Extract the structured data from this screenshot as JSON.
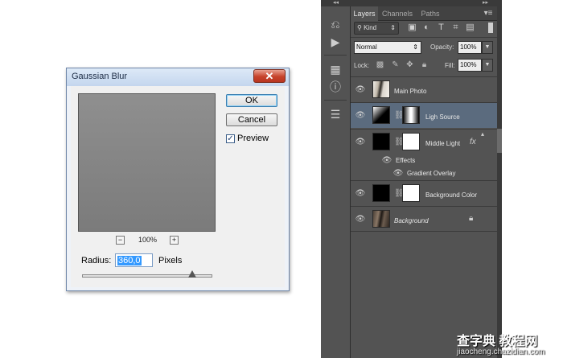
{
  "dialog": {
    "title": "Gaussian Blur",
    "close_glyph": "✕",
    "ok_label": "OK",
    "cancel_label": "Cancel",
    "preview_label": "Preview",
    "preview_checked": true,
    "zoom_out_glyph": "−",
    "zoom_in_glyph": "+",
    "zoom_level": "100%",
    "radius_label": "Radius:",
    "radius_value": "360,0",
    "radius_unit": "Pixels"
  },
  "tool_strip": {
    "top_glyph": "◂◂",
    "tools": [
      "history-icon",
      "play-icon",
      "swatches-icon",
      "info-icon",
      "properties-icon"
    ]
  },
  "panel": {
    "top_glyph": "▸▸",
    "tabs": [
      "Layers",
      "Channels",
      "Paths"
    ],
    "active_tab": "Layers",
    "menu_glyph": "▾≡",
    "filter_kind": "Kind",
    "filter_icons": [
      "image-filter-icon",
      "adjustment-filter-icon",
      "type-filter-icon",
      "shape-filter-icon",
      "smart-object-filter-icon"
    ],
    "blend_mode": "Normal",
    "opacity_label": "Opacity:",
    "opacity_value": "100%",
    "lock_label": "Lock:",
    "lock_icons": [
      "lock-transparent-icon",
      "lock-image-icon",
      "lock-position-icon",
      "lock-all-icon"
    ],
    "fill_label": "Fill:",
    "fill_value": "100%",
    "layers": [
      {
        "name": "Main Photo",
        "selected": false
      },
      {
        "name": "Ligh Source",
        "selected": true
      },
      {
        "name": "Middle Light",
        "selected": false,
        "fx": "fx"
      },
      {
        "name": "Background Color",
        "selected": false
      },
      {
        "name": "Background",
        "selected": false,
        "locked": true
      }
    ],
    "effects_label": "Effects",
    "effect_item": "Gradient Overlay",
    "selected_color": "#5b6b7e"
  },
  "watermark": {
    "line1": "查字典 教程网",
    "line2": "jiaocheng.chazidian.com"
  }
}
